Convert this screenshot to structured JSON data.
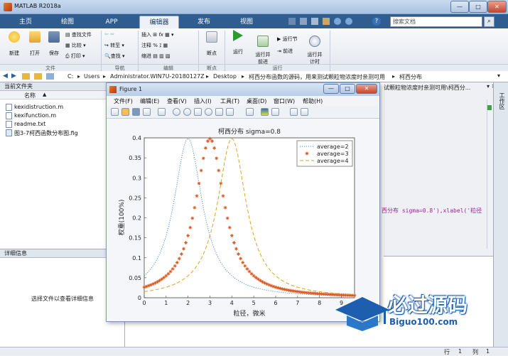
{
  "window": {
    "title": "MATLAB R2018a",
    "minimize": "—",
    "maximize": "□",
    "close": "✕"
  },
  "ribbon_tabs": [
    {
      "label": "主页"
    },
    {
      "label": "绘图"
    },
    {
      "label": "APP"
    },
    {
      "label": "编辑器"
    },
    {
      "label": "发布"
    },
    {
      "label": "视图"
    }
  ],
  "search": {
    "placeholder": "搜索文档"
  },
  "ribbon": {
    "file": {
      "new": "新建",
      "open": "打开",
      "save": "保存",
      "find_files": "查找文件",
      "compare": "比较",
      "print": "打印",
      "group": "文件"
    },
    "nav": {
      "goto": "转至",
      "find": "查找",
      "group": "导航"
    },
    "edit": {
      "insert": "插入",
      "comment": "注释",
      "indent": "缩进",
      "group": "编辑"
    },
    "breakpoints": {
      "label": "断点",
      "group": "断点"
    },
    "run": {
      "run": "运行",
      "run_advance": "运行并\n前进",
      "run_section": "运行节",
      "advance": "前进",
      "run_time": "运行并\n计时",
      "group": "运行"
    }
  },
  "path": {
    "segments": [
      "C:",
      "Users",
      "Administrator.WIN7U-20180127Z",
      "Desktop",
      "柯西分布函数的源码，用来测试颗粒物浓度时亲测可用",
      "柯西分布"
    ]
  },
  "current_folder": {
    "title": "当前文件夹",
    "column": "名称",
    "files": [
      "kexidistruction.m",
      "kexifunction.m",
      "readme.txt",
      "图3-7柯西函数分布图.fig"
    ]
  },
  "details": {
    "title": "详细信息",
    "hint": "选择文件以查看详细信息"
  },
  "editor_tab": {
    "label": "试颗粒物浓度时亲测可用\\柯西分..."
  },
  "workspace": {
    "title": "工作区"
  },
  "code_fragment": "西分布 sigma=0.8'),xlabel('粒径",
  "status": {
    "row_label": "行",
    "row": "1",
    "col_label": "列",
    "col": "1"
  },
  "figure": {
    "title": "Figure 1",
    "menu": [
      "文件(F)",
      "编辑(E)",
      "查看(V)",
      "插入(I)",
      "工具(T)",
      "桌面(D)",
      "窗口(W)",
      "帮助(H)"
    ]
  },
  "watermark": {
    "main": "必过源码",
    "sub": "Biguo100.com"
  },
  "chart_data": {
    "type": "line",
    "title": "柯西分布 sigma=0.8",
    "xlabel": "粒径，微米",
    "ylabel": "权重(100%)",
    "xlim": [
      0,
      9.6
    ],
    "ylim": [
      0,
      0.4
    ],
    "xticks": [
      0,
      1,
      2,
      3,
      4,
      5,
      6,
      7,
      8,
      9
    ],
    "yticks": [
      0,
      0.05,
      0.1,
      0.15,
      0.2,
      0.25,
      0.3,
      0.35,
      0.4
    ],
    "legend_position": "top-right",
    "sigma": 0.8,
    "series": [
      {
        "name": "average=2",
        "center": 2,
        "style": "dotted",
        "color": "#4a90c8"
      },
      {
        "name": "average=3",
        "center": 3,
        "style": "markers",
        "color": "#d9541a"
      },
      {
        "name": "average=4",
        "center": 4,
        "style": "dashed",
        "color": "#e0a020"
      }
    ]
  }
}
